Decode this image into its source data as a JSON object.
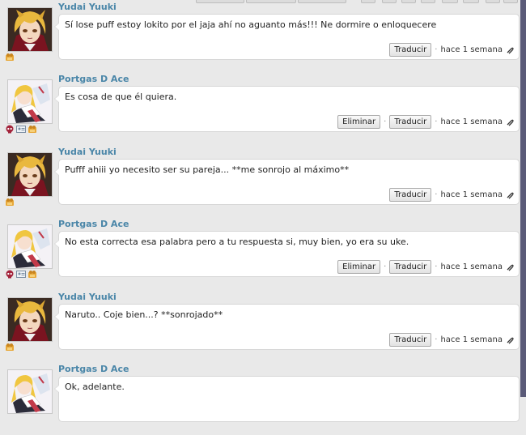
{
  "messages": [
    {
      "author": "Yudai Yuuki",
      "text": "Sí lose puff estoy lokito por el jaja ahí no aguanto más!!! Ne dormire o enloquecere",
      "buttons": [
        "Traducir"
      ],
      "time": "hace 1 semana",
      "avatar": "blonde-boy",
      "badges": [
        "paw-icon"
      ]
    },
    {
      "author": "Portgas D Ace",
      "text": "Es cosa de que él quiera.",
      "buttons": [
        "Eliminar",
        "Traducir"
      ],
      "time": "hace 1 semana",
      "avatar": "anime-girl",
      "badges": [
        "skull-icon",
        "id-card-icon",
        "paw-icon"
      ]
    },
    {
      "author": "Yudai Yuuki",
      "text": "Pufff ahiii yo necesito ser su pareja... **me sonrojo al máximo**",
      "buttons": [
        "Traducir"
      ],
      "time": "hace 1 semana",
      "avatar": "blonde-boy",
      "badges": [
        "paw-icon"
      ]
    },
    {
      "author": "Portgas D Ace",
      "text": "No esta correcta esa palabra pero a tu respuesta si, muy bien, yo era su uke.",
      "buttons": [
        "Eliminar",
        "Traducir"
      ],
      "time": "hace 1 semana",
      "avatar": "anime-girl",
      "badges": [
        "skull-icon",
        "id-card-icon",
        "paw-icon"
      ]
    },
    {
      "author": "Yudai Yuuki",
      "text": "Naruto.. Coje bien...? **sonrojado**",
      "buttons": [
        "Traducir"
      ],
      "time": "hace 1 semana",
      "avatar": "blonde-boy",
      "badges": [
        "paw-icon"
      ]
    },
    {
      "author": "Portgas D Ace",
      "text": "Ok, adelante.",
      "buttons": [],
      "time": "",
      "avatar": "anime-girl",
      "badges": []
    }
  ],
  "colors": {
    "author": "#4a86a8",
    "background": "#e9e9e9",
    "bubble": "#ffffff"
  }
}
